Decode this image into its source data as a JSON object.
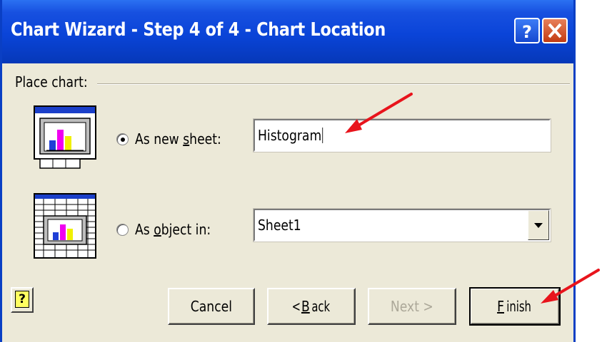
{
  "window": {
    "title": "Chart Wizard - Step 4 of 4 - Chart Location",
    "help_icon": "question-icon",
    "close_icon": "close-icon"
  },
  "place_chart": {
    "label": "Place chart:",
    "new_sheet": {
      "label_pre": "As new ",
      "label_accel": "s",
      "label_post": "heet:",
      "selected": true,
      "value": "Histogram"
    },
    "as_object": {
      "label_pre": "As ",
      "label_accel": "o",
      "label_post": "bject in:",
      "selected": false,
      "value": "Sheet1"
    }
  },
  "buttons": {
    "help": "?",
    "cancel": "Cancel",
    "back_pre": "< ",
    "back_accel": "B",
    "back_post": "ack",
    "next": "Next >",
    "finish_accel": "F",
    "finish_post": "inish"
  },
  "colors": {
    "title_bar": "#0a44d8",
    "dialog_bg": "#ece9d8",
    "annotation_arrow": "#e8141c",
    "chart_bars": [
      "#1f3fd6",
      "#f000f0",
      "#f0f000"
    ]
  }
}
